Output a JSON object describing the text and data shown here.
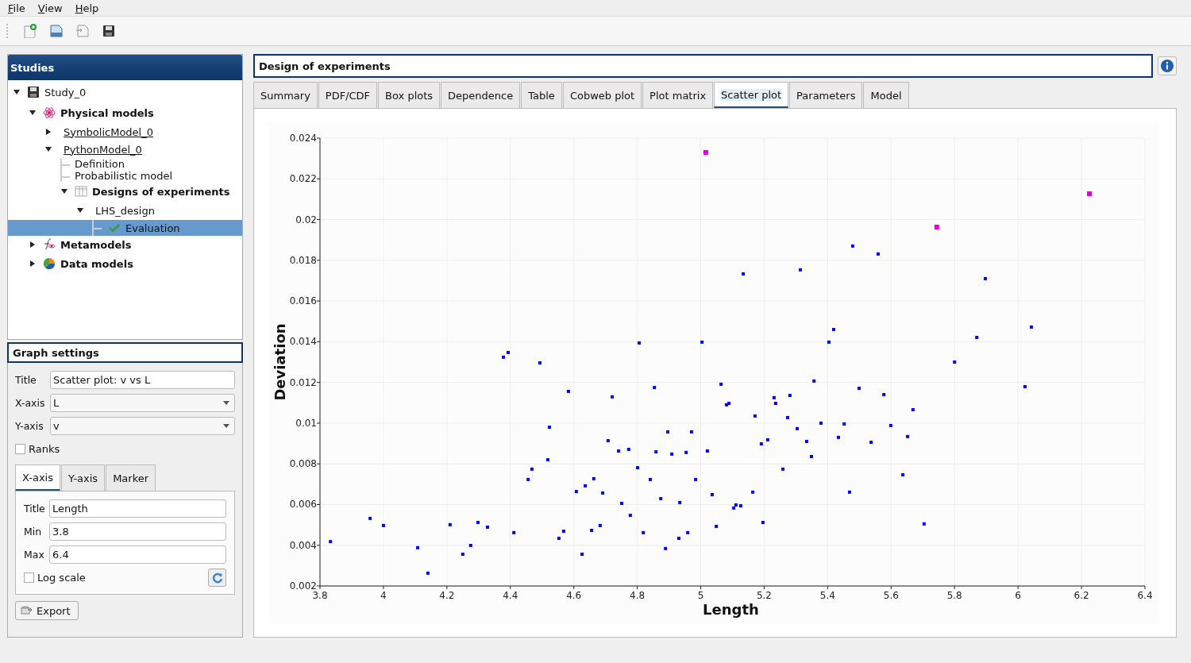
{
  "menu": [
    "File",
    "View",
    "Help"
  ],
  "studies": {
    "title": "Studies",
    "tree": [
      {
        "label": "Study_0",
        "kind": "study",
        "expanded": true,
        "selected": false,
        "children": [
          {
            "label": "Physical models",
            "kind": "physical",
            "expanded": true,
            "selected": false,
            "children": [
              {
                "label": "SymbolicModel_0",
                "kind": "model",
                "expanded": false,
                "selected": false
              },
              {
                "label": "PythonModel_0",
                "kind": "model",
                "expanded": true,
                "selected": false,
                "children": [
                  {
                    "label": "Definition",
                    "kind": "leaf",
                    "selected": false
                  },
                  {
                    "label": "Probabilistic model",
                    "kind": "leaf",
                    "selected": false
                  },
                  {
                    "label": "Designs of experiments",
                    "kind": "doe",
                    "expanded": true,
                    "selected": false,
                    "children": [
                      {
                        "label": "LHS_design",
                        "kind": "design",
                        "expanded": true,
                        "selected": false,
                        "children": [
                          {
                            "label": "Evaluation",
                            "kind": "evaluation",
                            "selected": true
                          }
                        ]
                      }
                    ]
                  }
                ]
              }
            ]
          },
          {
            "label": "Metamodels",
            "kind": "meta",
            "expanded": false,
            "selected": false
          },
          {
            "label": "Data models",
            "kind": "data",
            "expanded": false,
            "selected": false
          }
        ]
      }
    ]
  },
  "graph_settings": {
    "title": "Graph settings",
    "fields": [
      {
        "label": "Title",
        "kind": "text",
        "value": "Scatter plot: v vs L"
      },
      {
        "label": "X-axis",
        "kind": "combo",
        "value": "L"
      },
      {
        "label": "Y-axis",
        "kind": "combo",
        "value": "v"
      }
    ],
    "ranks": {
      "label": "Ranks",
      "checked": false
    },
    "tabs": [
      {
        "label": "X-axis",
        "selected": true
      },
      {
        "label": "Y-axis",
        "selected": false
      },
      {
        "label": "Marker",
        "selected": false
      }
    ],
    "axis_fields": [
      {
        "label": "Title",
        "value": "Length"
      },
      {
        "label": "Min",
        "value": "3.8"
      },
      {
        "label": "Max",
        "value": "6.4"
      }
    ],
    "log_scale": {
      "label": "Log scale",
      "checked": false
    },
    "export": "Export"
  },
  "main": {
    "title": "Design of experiments",
    "tabs": [
      {
        "label": "Summary",
        "selected": false
      },
      {
        "label": "PDF/CDF",
        "selected": false
      },
      {
        "label": "Box plots",
        "selected": false
      },
      {
        "label": "Dependence",
        "selected": false
      },
      {
        "label": "Table",
        "selected": false
      },
      {
        "label": "Cobweb plot",
        "selected": false
      },
      {
        "label": "Plot matrix",
        "selected": false
      },
      {
        "label": "Scatter plot",
        "selected": true
      },
      {
        "label": "Parameters",
        "selected": false
      },
      {
        "label": "Model",
        "selected": false
      }
    ],
    "chart_data": {
      "type": "scatter",
      "grid": true,
      "xlabel": "Length",
      "ylabel": "Deviation",
      "xlim": [
        3.8,
        6.4
      ],
      "ylim": [
        0.002,
        0.024
      ],
      "xticks": [
        3.8,
        4,
        4.2,
        4.4,
        4.6,
        4.8,
        5,
        5.2,
        5.4,
        5.6,
        5.8,
        6,
        6.2,
        6.4
      ],
      "yticks": [
        0.002,
        0.004,
        0.006,
        0.008,
        0.01,
        0.012,
        0.014,
        0.016,
        0.018,
        0.02,
        0.022,
        0.024
      ],
      "series": [
        {
          "color": "#0000ff",
          "x": [
            3.833,
            3.958,
            4.0,
            4.108,
            4.14,
            4.21,
            4.25,
            4.275,
            4.298,
            4.328,
            4.378,
            4.393,
            4.411,
            4.456,
            4.468,
            4.493,
            4.518,
            4.523,
            4.583,
            4.553,
            4.568,
            4.608,
            4.626,
            4.636,
            4.656,
            4.663,
            4.683,
            4.691,
            4.708,
            4.721,
            4.741,
            4.751,
            4.773,
            4.778,
            4.801,
            4.806,
            4.819,
            4.841,
            4.854,
            4.859,
            4.874,
            4.889,
            4.896,
            4.909,
            4.931,
            4.934,
            4.954,
            4.959,
            4.971,
            4.984,
            5.004,
            5.021,
            5.036,
            5.049,
            5.064,
            5.081,
            5.089,
            5.104,
            5.111,
            5.126,
            5.134,
            5.164,
            5.171,
            5.191,
            5.196,
            5.211,
            5.231,
            5.236,
            5.259,
            5.274,
            5.281,
            5.304,
            5.314,
            5.334,
            5.349,
            5.357,
            5.379,
            5.404,
            5.419,
            5.434,
            5.452,
            5.469,
            5.479,
            5.499,
            5.537,
            5.559,
            5.577,
            5.599,
            5.637,
            5.652,
            5.669,
            5.704,
            5.8,
            5.87,
            5.897,
            6.022,
            6.042
          ],
          "values": [
            0.00418,
            0.00532,
            0.00497,
            0.00388,
            0.00263,
            0.00501,
            0.00356,
            0.00399,
            0.00512,
            0.00489,
            0.01324,
            0.01347,
            0.00462,
            0.00723,
            0.00774,
            0.01296,
            0.0082,
            0.0098,
            0.01156,
            0.00434,
            0.00469,
            0.00664,
            0.00356,
            0.00692,
            0.00473,
            0.00727,
            0.00497,
            0.00657,
            0.00914,
            0.01129,
            0.00863,
            0.00606,
            0.00871,
            0.00547,
            0.00781,
            0.01394,
            0.00462,
            0.00723,
            0.01175,
            0.00859,
            0.00629,
            0.00384,
            0.00957,
            0.00848,
            0.00434,
            0.0061,
            0.00856,
            0.00462,
            0.00957,
            0.00723,
            0.01398,
            0.00863,
            0.00649,
            0.00493,
            0.01191,
            0.0109,
            0.01097,
            0.00583,
            0.00598,
            0.00594,
            0.01733,
            0.00661,
            0.01035,
            0.00898,
            0.00512,
            0.00918,
            0.01125,
            0.01097,
            0.00774,
            0.01027,
            0.01136,
            0.00973,
            0.01753,
            0.0091,
            0.00836,
            0.01207,
            0.01,
            0.01398,
            0.0146,
            0.0093,
            0.00996,
            0.00661,
            0.0187,
            0.01171,
            0.00906,
            0.01831,
            0.0114,
            0.00988,
            0.00746,
            0.00934,
            0.01066,
            0.00505,
            0.013,
            0.01421,
            0.0171,
            0.01179,
            0.01472
          ]
        },
        {
          "color": "#e000e0",
          "x": [
            5.016,
            5.744,
            6.225
          ],
          "values": [
            0.0233,
            0.01963,
            0.02127
          ]
        }
      ]
    }
  }
}
